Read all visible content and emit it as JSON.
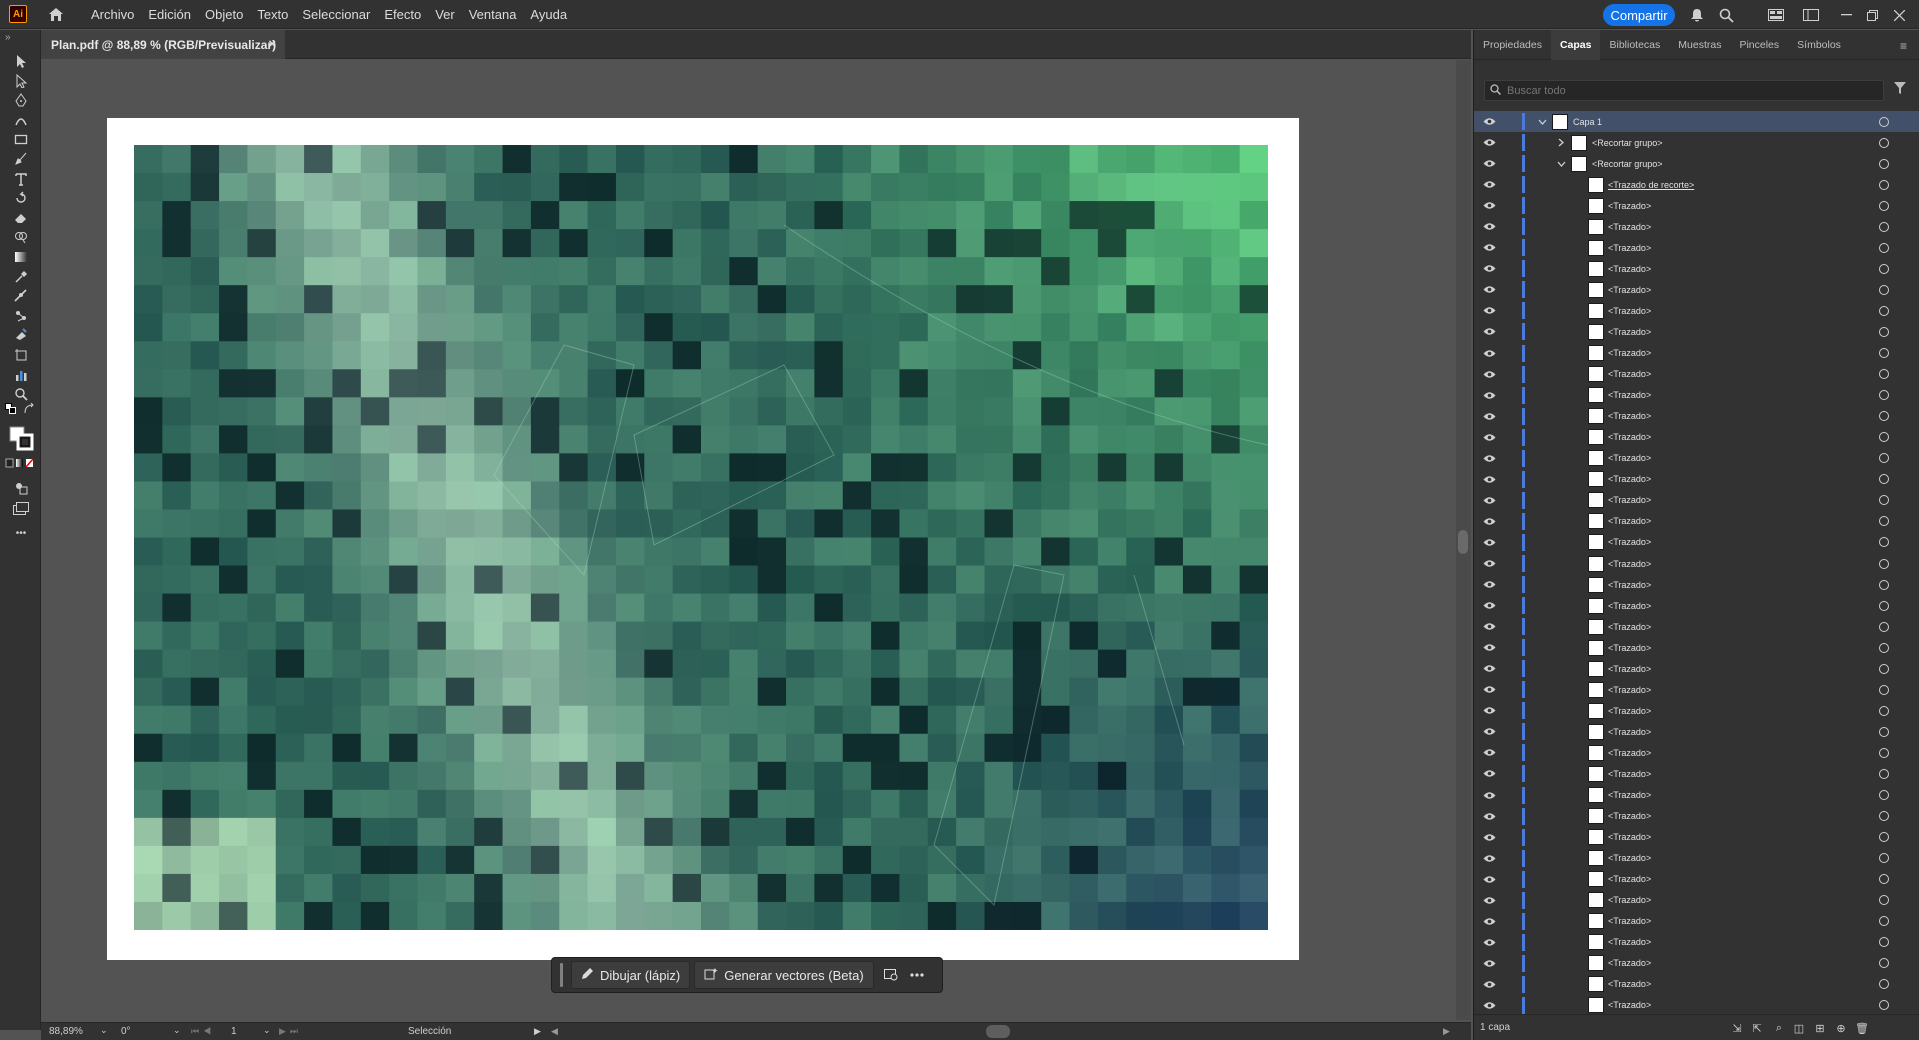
{
  "app": {
    "logo_text": "Ai",
    "accent_color": "#ff9a00",
    "brand_bg": "#330000"
  },
  "menubar": {
    "items": [
      "Archivo",
      "Edición",
      "Objeto",
      "Texto",
      "Seleccionar",
      "Efecto",
      "Ver",
      "Ventana",
      "Ayuda"
    ],
    "share_label": "Compartir",
    "share_color": "#1473e6"
  },
  "document": {
    "tab_title": "Plan.pdf @ 88,89 % (RGB/Previsualizar)",
    "close_glyph": "×"
  },
  "context_bar": {
    "draw_label": "Dibujar (lápiz)",
    "generate_label": "Generar vectores (Beta)"
  },
  "status": {
    "zoom": "88,89%",
    "rotation": "0°",
    "page": "1",
    "tool": "Selección"
  },
  "panel": {
    "tabs": [
      "Propiedades",
      "Capas",
      "Bibliotecas",
      "Muestras",
      "Pinceles",
      "Símbolos"
    ],
    "active_tab": "Capas",
    "search_placeholder": "Buscar todo",
    "layer_count": "1 capa",
    "layer_color": "#4a7bdc",
    "rows": [
      {
        "name": "Capa 1",
        "level": 0,
        "expand": "open",
        "selected": true
      },
      {
        "name": "<Recortar grupo>",
        "level": 1,
        "expand": "closed"
      },
      {
        "name": "<Recortar grupo>",
        "level": 1,
        "expand": "open"
      },
      {
        "name": "<Trazado de recorte>",
        "level": 2,
        "expand": "none",
        "clip": true
      },
      {
        "name": "<Trazado>",
        "level": 2,
        "expand": "none"
      },
      {
        "name": "<Trazado>",
        "level": 2,
        "expand": "none"
      },
      {
        "name": "<Trazado>",
        "level": 2,
        "expand": "none"
      },
      {
        "name": "<Trazado>",
        "level": 2,
        "expand": "none"
      },
      {
        "name": "<Trazado>",
        "level": 2,
        "expand": "none"
      },
      {
        "name": "<Trazado>",
        "level": 2,
        "expand": "none"
      },
      {
        "name": "<Trazado>",
        "level": 2,
        "expand": "none"
      },
      {
        "name": "<Trazado>",
        "level": 2,
        "expand": "none"
      },
      {
        "name": "<Trazado>",
        "level": 2,
        "expand": "none"
      },
      {
        "name": "<Trazado>",
        "level": 2,
        "expand": "none"
      },
      {
        "name": "<Trazado>",
        "level": 2,
        "expand": "none"
      },
      {
        "name": "<Trazado>",
        "level": 2,
        "expand": "none"
      },
      {
        "name": "<Trazado>",
        "level": 2,
        "expand": "none"
      },
      {
        "name": "<Trazado>",
        "level": 2,
        "expand": "none"
      },
      {
        "name": "<Trazado>",
        "level": 2,
        "expand": "none"
      },
      {
        "name": "<Trazado>",
        "level": 2,
        "expand": "none"
      },
      {
        "name": "<Trazado>",
        "level": 2,
        "expand": "none"
      },
      {
        "name": "<Trazado>",
        "level": 2,
        "expand": "none"
      },
      {
        "name": "<Trazado>",
        "level": 2,
        "expand": "none"
      },
      {
        "name": "<Trazado>",
        "level": 2,
        "expand": "none"
      },
      {
        "name": "<Trazado>",
        "level": 2,
        "expand": "none"
      },
      {
        "name": "<Trazado>",
        "level": 2,
        "expand": "none"
      },
      {
        "name": "<Trazado>",
        "level": 2,
        "expand": "none"
      },
      {
        "name": "<Trazado>",
        "level": 2,
        "expand": "none"
      },
      {
        "name": "<Trazado>",
        "level": 2,
        "expand": "none"
      },
      {
        "name": "<Trazado>",
        "level": 2,
        "expand": "none"
      },
      {
        "name": "<Trazado>",
        "level": 2,
        "expand": "none"
      },
      {
        "name": "<Trazado>",
        "level": 2,
        "expand": "none"
      },
      {
        "name": "<Trazado>",
        "level": 2,
        "expand": "none"
      },
      {
        "name": "<Trazado>",
        "level": 2,
        "expand": "none"
      },
      {
        "name": "<Trazado>",
        "level": 2,
        "expand": "none"
      },
      {
        "name": "<Trazado>",
        "level": 2,
        "expand": "none"
      },
      {
        "name": "<Trazado>",
        "level": 2,
        "expand": "none"
      },
      {
        "name": "<Trazado>",
        "level": 2,
        "expand": "none"
      },
      {
        "name": "<Trazado>",
        "level": 2,
        "expand": "none"
      },
      {
        "name": "<Trazado>",
        "level": 2,
        "expand": "none"
      },
      {
        "name": "<Trazado>",
        "level": 2,
        "expand": "none"
      },
      {
        "name": "<Trazado>",
        "level": 2,
        "expand": "none"
      },
      {
        "name": "<Trazado>",
        "level": 2,
        "expand": "none"
      },
      {
        "name": "<Trazado>",
        "level": 2,
        "expand": "none"
      }
    ]
  },
  "toolbar": {
    "tools": [
      "selection-tool",
      "direct-selection-tool",
      "pen-tool",
      "curvature-tool",
      "rectangle-tool",
      "paintbrush-tool",
      "type-tool",
      "rotate-tool",
      "eraser-tool",
      "shape-builder-tool",
      "gradient-tool",
      "eyedropper-tool",
      "blend-tool",
      "puppet-warp-tool",
      "live-paint-tool",
      "artboard-tool",
      "graph-tool",
      "zoom-tool"
    ],
    "more_glyph": "•••"
  }
}
